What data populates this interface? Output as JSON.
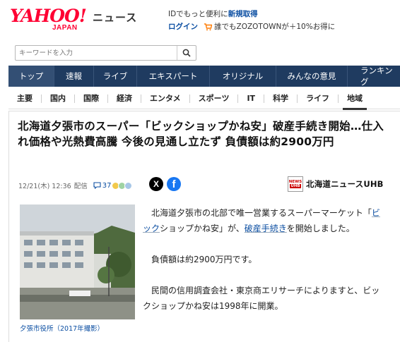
{
  "header": {
    "logo_main": "YAHOO!",
    "logo_sub": "JAPAN",
    "service": "ニュース",
    "promo_line1_prefix": "IDでもっと便利に",
    "promo_line1_link": "新規取得",
    "login": "ログイン",
    "promo_line2": "誰でもZOZOTOWNが＋10%お得に"
  },
  "search": {
    "placeholder": "キーワードを入力"
  },
  "main_tabs": [
    {
      "label": "トップ"
    },
    {
      "label": "速報"
    },
    {
      "label": "ライブ"
    },
    {
      "label": "エキスパート"
    },
    {
      "label": "オリジナル"
    },
    {
      "label": "みんなの意見"
    },
    {
      "label": "ランキング"
    }
  ],
  "sub_tabs": [
    {
      "label": "主要"
    },
    {
      "label": "国内"
    },
    {
      "label": "国際"
    },
    {
      "label": "経済"
    },
    {
      "label": "エンタメ"
    },
    {
      "label": "スポーツ"
    },
    {
      "label": "IT"
    },
    {
      "label": "科学"
    },
    {
      "label": "ライフ"
    },
    {
      "label": "地域"
    }
  ],
  "article": {
    "title": "北海道夕張市のスーパー「ビックショップかね安」破産手続き開始…仕入れ価格や光熱費高騰 今後の見通し立たず 負債額は約2900万円",
    "date": "12/21(木) 12:36",
    "dist": "配信",
    "comment_count": "37",
    "publisher": "北海道ニュースUHB",
    "publisher_badge_top": "NEWS",
    "publisher_badge_bottom": "UHB",
    "share_x": "X",
    "share_fb": "f",
    "caption": "夕張市役所（2017年撮影）",
    "p1_a": "　北海道夕張市の北部で唯一営業するスーパーマーケット「",
    "p1_link1": "ビック",
    "p1_b": "ショップかね安」が、",
    "p1_link2": "破産手続き",
    "p1_c": "を開始しました。",
    "p2": "　負債額は約2900万円です。",
    "p3": "　民間の信用調査会社・東京商エリサーチによりますと、ビックショップかね安は1998年に開業。"
  },
  "colors": {
    "brand_red": "#ff0033",
    "nav_bg": "#1f3b60",
    "link_blue": "#0b4ea2",
    "x_black": "#000000",
    "facebook_blue": "#1877f2"
  },
  "icons": [
    "cart-icon",
    "search-icon",
    "comment-icon",
    "x-icon",
    "facebook-icon"
  ]
}
